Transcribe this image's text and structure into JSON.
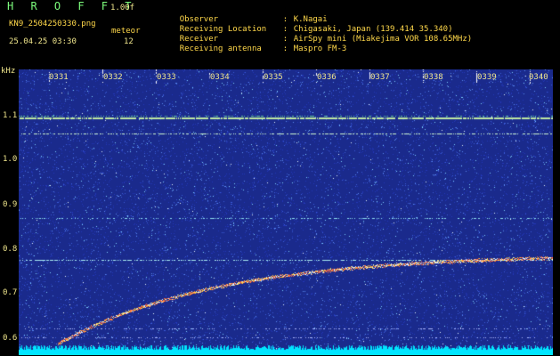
{
  "header": {
    "logo": "H R O F F T",
    "version": "1.00f",
    "filename": "KN9_2504250330.png",
    "meteor_label": "meteor",
    "datetime": "25.04.25 03:30",
    "meteor_count": "12"
  },
  "info": [
    {
      "key": "Observer",
      "value": "K.Nagai"
    },
    {
      "key": "Receiving Location",
      "value": "Chigasaki, Japan (139.414 35.340)"
    },
    {
      "key": "Receiver",
      "value": "AirSpy mini (Miakejima VOR 108.65MHz)"
    },
    {
      "key": "Receiving antenna",
      "value": "Maspro FM-3"
    }
  ],
  "axis": {
    "y_unit": "kHz",
    "y_ticks": [
      "1.1",
      "1.0",
      "0.9",
      "0.8",
      "0.7",
      "0.6"
    ],
    "x_ticks": [
      "0331",
      "0332",
      "0333",
      "0334",
      "0335",
      "0336",
      "0337",
      "0338",
      "0339",
      "0340"
    ]
  },
  "colors": {
    "background": "#1A2A8C",
    "header_text": "#FFD84A",
    "logo": "#7CFC7C",
    "baseline": "#00E5FF"
  }
}
